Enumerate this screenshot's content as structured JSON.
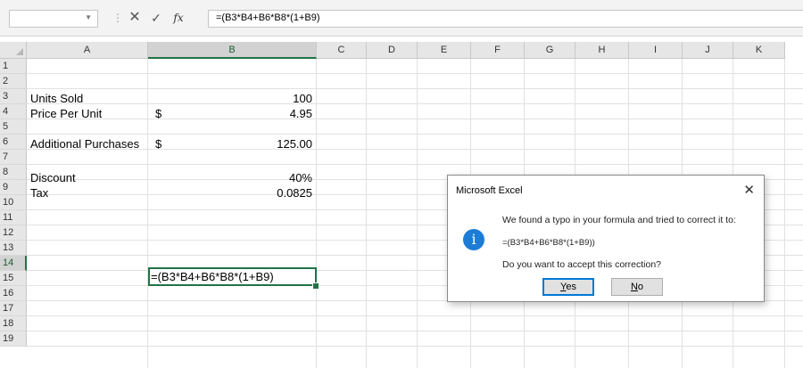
{
  "formula_bar": {
    "name_box": "",
    "dots": "⋮",
    "cancel_glyph": "✕",
    "enter_glyph": "✓",
    "fx_label": "fx",
    "content": "=(B3*B4+B6*B8*(1+B9)"
  },
  "columns": [
    "A",
    "B",
    "C",
    "D",
    "E",
    "F",
    "G",
    "H",
    "I",
    "J",
    "K"
  ],
  "selected_column": "B",
  "rows": [
    "1",
    "2",
    "3",
    "4",
    "5",
    "6",
    "7",
    "8",
    "9",
    "10",
    "11",
    "12",
    "13",
    "14",
    "15",
    "16",
    "17",
    "18",
    "19"
  ],
  "selected_row": "14",
  "cells": {
    "A3": "Units Sold",
    "B3": "100",
    "A4": "Price Per Unit",
    "B4_symbol": "$",
    "B4": "4.95",
    "A6": "Additional Purchases",
    "B6_symbol": "$",
    "B6": "125.00",
    "A8": "Discount",
    "B8": "40%",
    "A9": "Tax",
    "B9": "0.0825",
    "B14": "=(B3*B4+B6*B8*(1+B9)"
  },
  "dialog": {
    "title": "Microsoft Excel",
    "close_glyph": "✕",
    "info_glyph": "i",
    "message": "We found a typo in your formula and tried to correct it to:",
    "formula": "=(B3*B4+B6*B8*(1+B9))",
    "question": "Do you want to accept this correction?",
    "yes_underlined": "Y",
    "yes_rest": "es",
    "no_underlined": "N",
    "no_rest": "o"
  }
}
